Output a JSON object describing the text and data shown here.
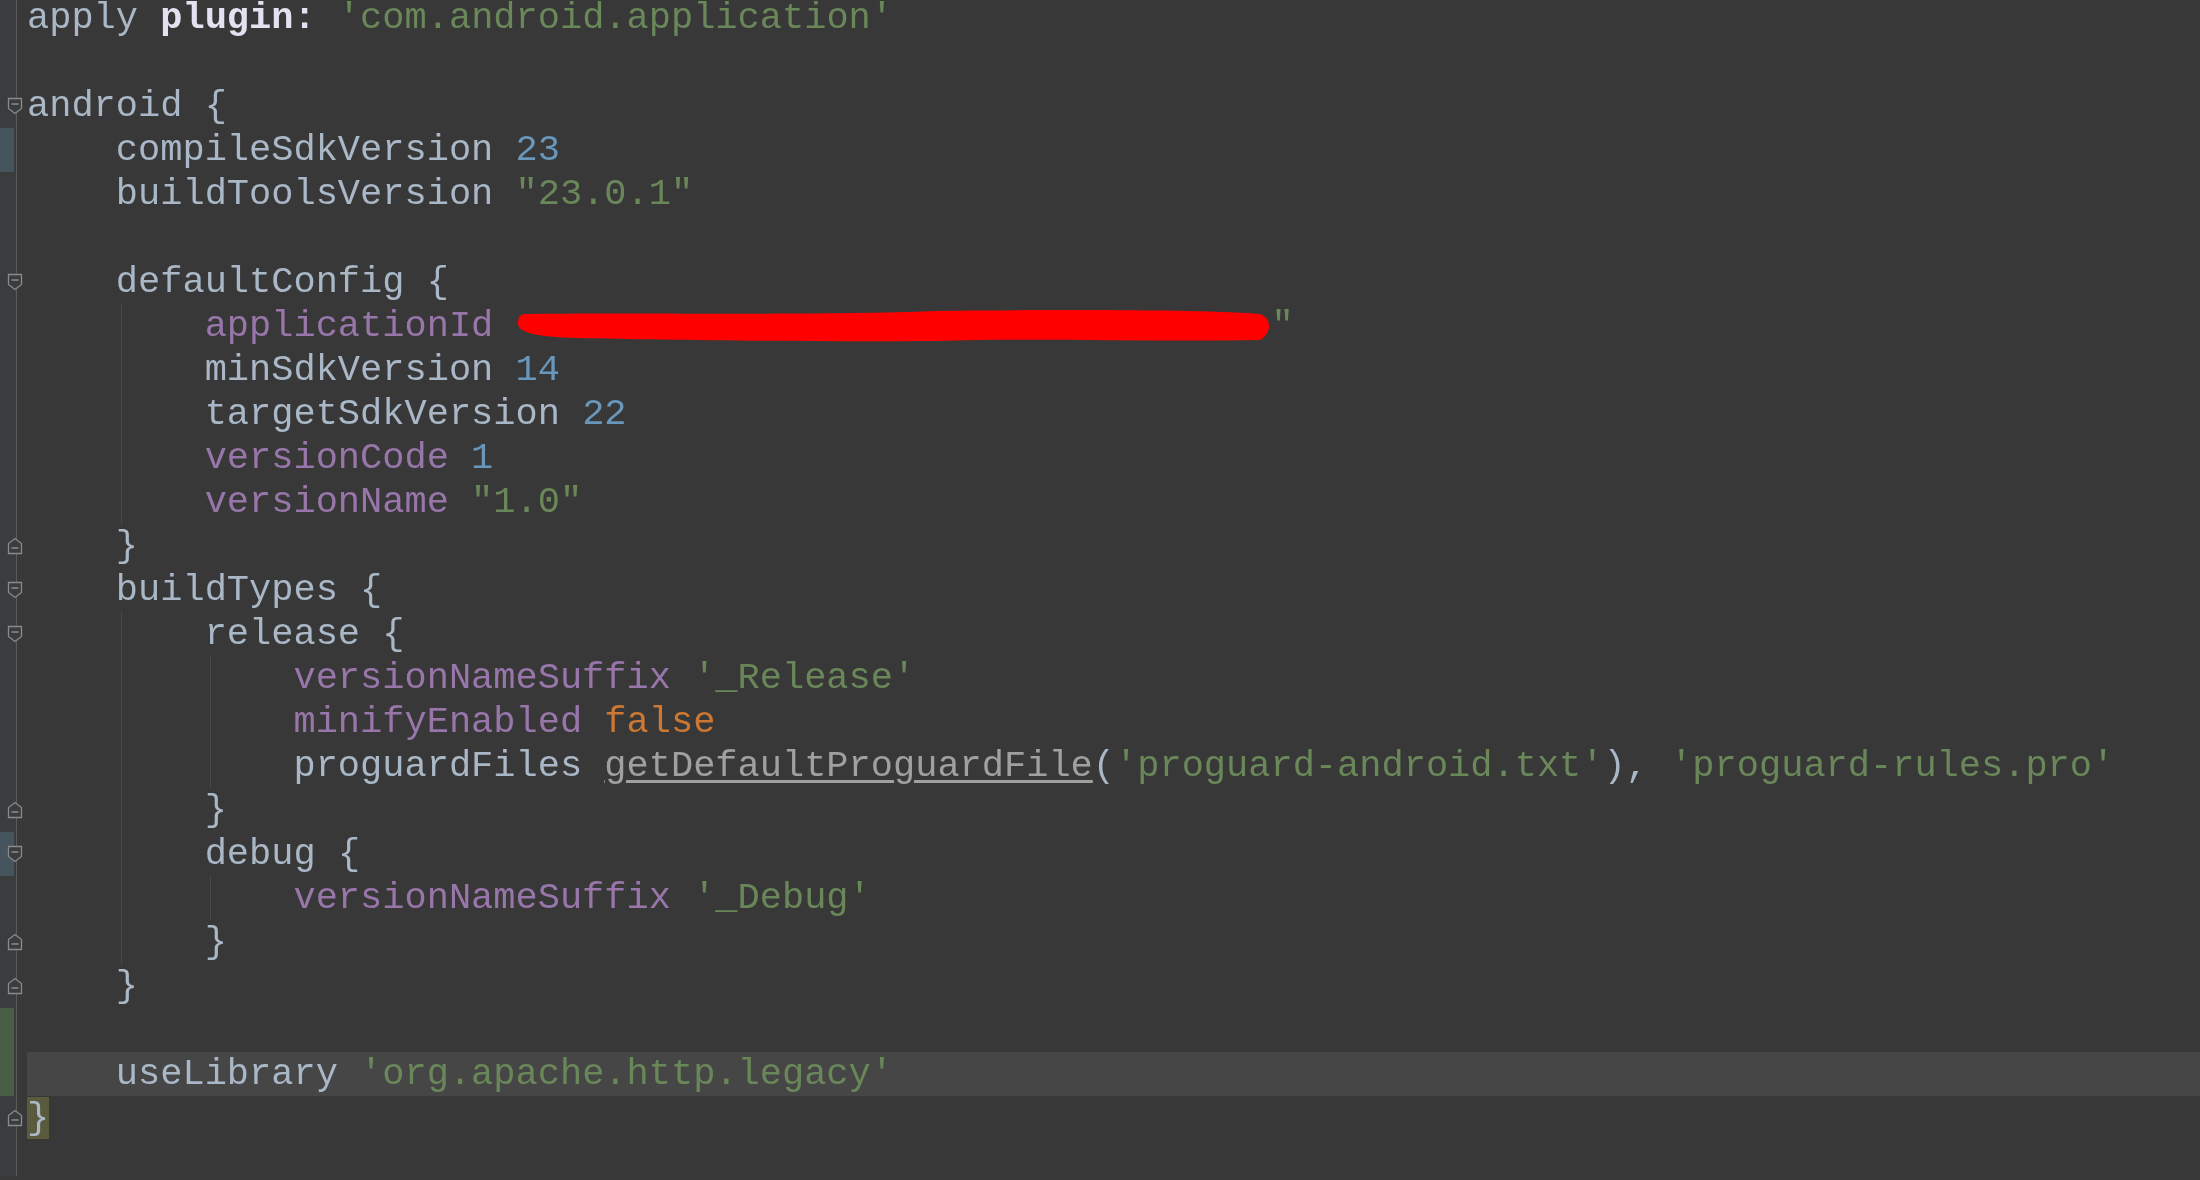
{
  "editor": {
    "lines": [
      {
        "current": false,
        "tokens": [
          {
            "text": "apply",
            "kind": "plain"
          },
          {
            "text": "plugin:",
            "kind": "keyword"
          },
          {
            "text": "'com.android.application'",
            "kind": "string"
          }
        ]
      },
      {
        "current": false
      },
      {
        "current": false,
        "fold": {
          "kind": "start"
        },
        "tokens": [
          {
            "text": "android",
            "kind": "plain"
          },
          {
            "text": "{",
            "kind": "punct"
          }
        ]
      },
      {
        "current": false,
        "change": {
          "kind": "modified"
        },
        "tokens": [
          {
            "text": "    compileSdkVersion",
            "kind": "plain"
          },
          {
            "text": "23",
            "kind": "number"
          }
        ]
      },
      {
        "current": false,
        "tokens": [
          {
            "text": "    buildToolsVersion",
            "kind": "plain"
          },
          {
            "text": "\"23.0.1\"",
            "kind": "string"
          }
        ]
      },
      {
        "current": false
      },
      {
        "current": false,
        "fold": {
          "kind": "start"
        },
        "tokens": [
          {
            "text": "    defaultConfig",
            "kind": "plain"
          },
          {
            "text": "{",
            "kind": "punct"
          }
        ]
      },
      {
        "current": false,
        "tokens": [
          {
            "text": "        applicationId",
            "kind": "property"
          },
          {
            "kind": "redaction"
          },
          {
            "text": "\"",
            "kind": "string"
          }
        ]
      },
      {
        "current": false,
        "tokens": [
          {
            "text": "        minSdkVersion",
            "kind": "plain"
          },
          {
            "text": "14",
            "kind": "number"
          }
        ]
      },
      {
        "current": false,
        "tokens": [
          {
            "text": "        targetSdkVersion",
            "kind": "plain"
          },
          {
            "text": "22",
            "kind": "number"
          }
        ]
      },
      {
        "current": false,
        "tokens": [
          {
            "text": "        versionCode",
            "kind": "property"
          },
          {
            "text": "1",
            "kind": "number"
          }
        ]
      },
      {
        "current": false,
        "tokens": [
          {
            "text": "        versionName",
            "kind": "property"
          },
          {
            "text": "\"1.0\"",
            "kind": "string"
          }
        ]
      },
      {
        "current": false,
        "fold": {
          "kind": "end"
        },
        "tokens": [
          {
            "text": "    }",
            "kind": "punct"
          }
        ]
      },
      {
        "current": false,
        "fold": {
          "kind": "start"
        },
        "tokens": [
          {
            "text": "    buildTypes",
            "kind": "plain"
          },
          {
            "text": "{",
            "kind": "punct"
          }
        ]
      },
      {
        "current": false,
        "fold": {
          "kind": "start"
        },
        "tokens": [
          {
            "text": "        release",
            "kind": "plain"
          },
          {
            "text": "{",
            "kind": "punct"
          }
        ]
      },
      {
        "current": false,
        "tokens": [
          {
            "text": "            versionNameSuffix",
            "kind": "property"
          },
          {
            "text": "'_Release'",
            "kind": "string"
          }
        ]
      },
      {
        "current": false,
        "tokens": [
          {
            "text": "            minifyEnabled",
            "kind": "property"
          },
          {
            "text": "false",
            "kind": "bool"
          }
        ]
      },
      {
        "current": false,
        "tokens": [
          {
            "text": "            proguardFiles",
            "kind": "plain"
          },
          {
            "text": "getDefaultProguardFile",
            "kind": "method"
          },
          {
            "text": "(",
            "kind": "call-open"
          },
          {
            "text": "'proguard-android.txt'",
            "kind": "string"
          },
          {
            "text": "),",
            "kind": "call-close"
          },
          {
            "text": "'proguard-rules.pro'",
            "kind": "string"
          }
        ]
      },
      {
        "current": false,
        "fold": {
          "kind": "end"
        },
        "tokens": [
          {
            "text": "        }",
            "kind": "punct"
          }
        ]
      },
      {
        "current": false,
        "fold": {
          "kind": "start"
        },
        "change": {
          "kind": "modified"
        },
        "tokens": [
          {
            "text": "        debug",
            "kind": "plain"
          },
          {
            "text": "{",
            "kind": "punct"
          }
        ]
      },
      {
        "current": false,
        "tokens": [
          {
            "text": "            versionNameSuffix",
            "kind": "property"
          },
          {
            "text": "'_Debug'",
            "kind": "string"
          }
        ]
      },
      {
        "current": false,
        "fold": {
          "kind": "end"
        },
        "tokens": [
          {
            "text": "        }",
            "kind": "punct"
          }
        ]
      },
      {
        "current": false,
        "fold": {
          "kind": "end"
        },
        "tokens": [
          {
            "text": "    }",
            "kind": "punct"
          }
        ]
      },
      {
        "current": false,
        "change": {
          "kind": "added"
        }
      },
      {
        "current": true,
        "change": {
          "kind": "added"
        },
        "tokens": [
          {
            "text": "    useLibrary",
            "kind": "plain"
          },
          {
            "text": "'org.apache.http.legacy'",
            "kind": "string"
          }
        ]
      },
      {
        "current": false,
        "fold": {
          "kind": "end"
        },
        "tokens": [
          {
            "text": "}",
            "kind": "brace-match"
          }
        ]
      }
    ]
  }
}
